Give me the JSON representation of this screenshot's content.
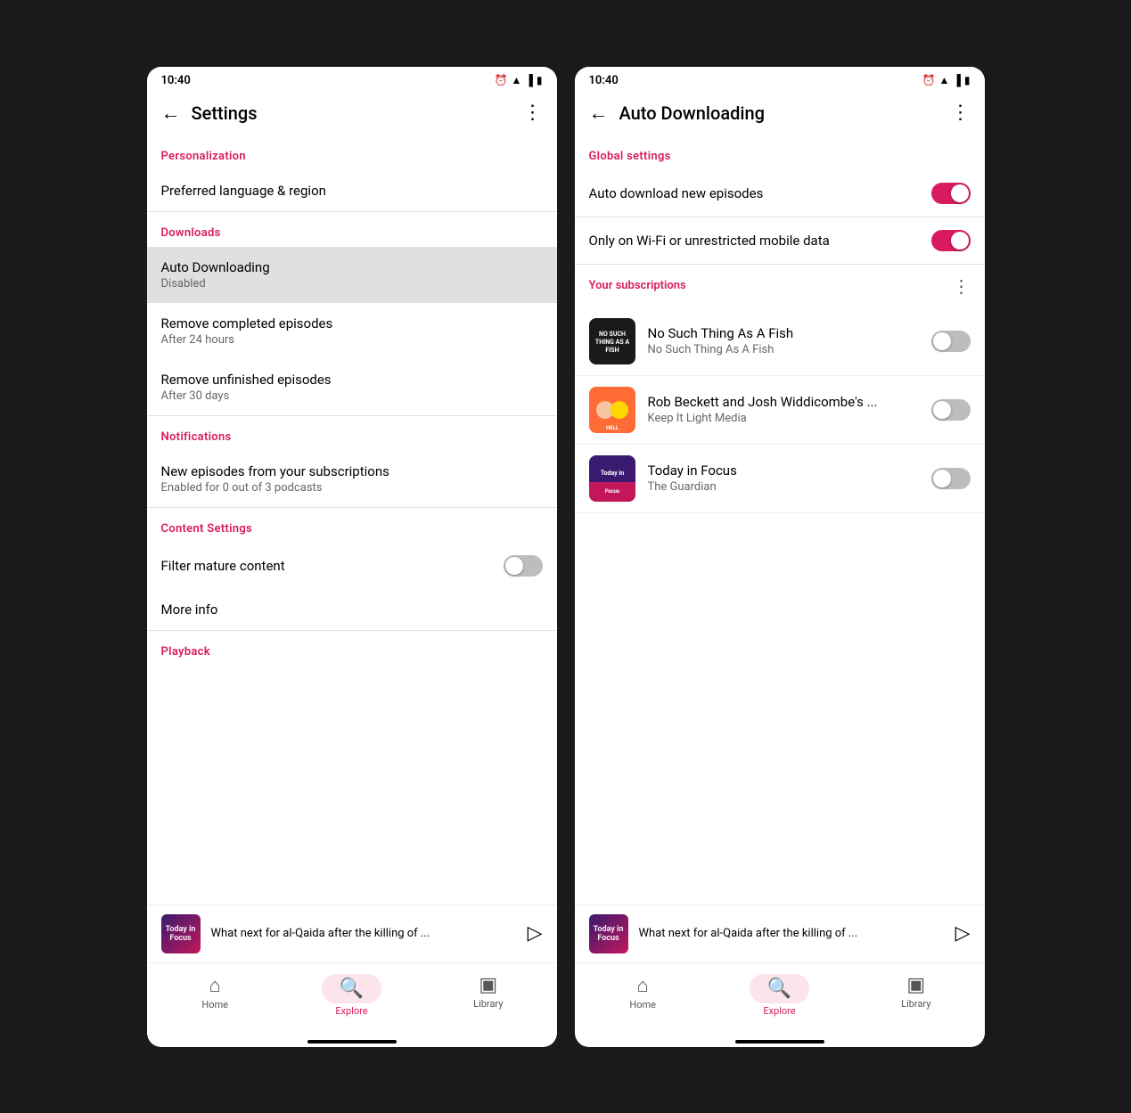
{
  "screens": [
    {
      "id": "settings",
      "status_time": "10:40",
      "app_bar_title": "Settings",
      "sections": [
        {
          "header": "Personalization",
          "items": [
            {
              "title": "Preferred language & region",
              "subtitle": null
            }
          ]
        },
        {
          "header": "Downloads",
          "items": [
            {
              "title": "Auto Downloading",
              "subtitle": "Disabled",
              "highlighted": true
            },
            {
              "title": "Remove completed episodes",
              "subtitle": "After 24 hours"
            },
            {
              "title": "Remove unfinished episodes",
              "subtitle": "After 30 days"
            }
          ]
        },
        {
          "header": "Notifications",
          "items": [
            {
              "title": "New episodes from your subscriptions",
              "subtitle": "Enabled for 0 out of 3 podcasts"
            }
          ]
        },
        {
          "header": "Content Settings",
          "items": [
            {
              "title": "Filter mature content",
              "has_toggle": true,
              "toggle_on": false
            },
            {
              "title": "More info",
              "subtitle": null
            }
          ]
        },
        {
          "header": "Playback",
          "items": []
        }
      ],
      "mini_player": {
        "title": "What next for al-Qaida after the killing of ..."
      },
      "bottom_nav": [
        {
          "label": "Home",
          "icon": "⌂",
          "active": false
        },
        {
          "label": "Explore",
          "icon": "🔍",
          "active": true
        },
        {
          "label": "Library",
          "icon": "▣",
          "active": false
        }
      ]
    },
    {
      "id": "auto_downloading",
      "status_time": "10:40",
      "app_bar_title": "Auto Downloading",
      "global_settings_header": "Global settings",
      "global_items": [
        {
          "title": "Auto download new episodes",
          "toggle_on": true
        },
        {
          "title": "Only on Wi-Fi or unrestricted mobile data",
          "toggle_on": true
        }
      ],
      "subscriptions_header": "Your subscriptions",
      "podcasts": [
        {
          "name": "No Such Thing As A Fish",
          "author": "No Such Thing As A Fish",
          "art_type": "fish",
          "toggle_on": false
        },
        {
          "name": "Rob Beckett and Josh Widdicombe's ...",
          "author": "Keep It Light Media",
          "art_type": "rob",
          "toggle_on": false
        },
        {
          "name": "Today in Focus",
          "author": "The Guardian",
          "art_type": "focus",
          "toggle_on": false
        }
      ],
      "mini_player": {
        "title": "What next for al-Qaida after the killing of ..."
      },
      "bottom_nav": [
        {
          "label": "Home",
          "icon": "⌂",
          "active": false
        },
        {
          "label": "Explore",
          "icon": "🔍",
          "active": true
        },
        {
          "label": "Library",
          "icon": "▣",
          "active": false
        }
      ]
    }
  ],
  "accent_color": "#d81b60",
  "toggle_off_color": "#bdbdbd"
}
